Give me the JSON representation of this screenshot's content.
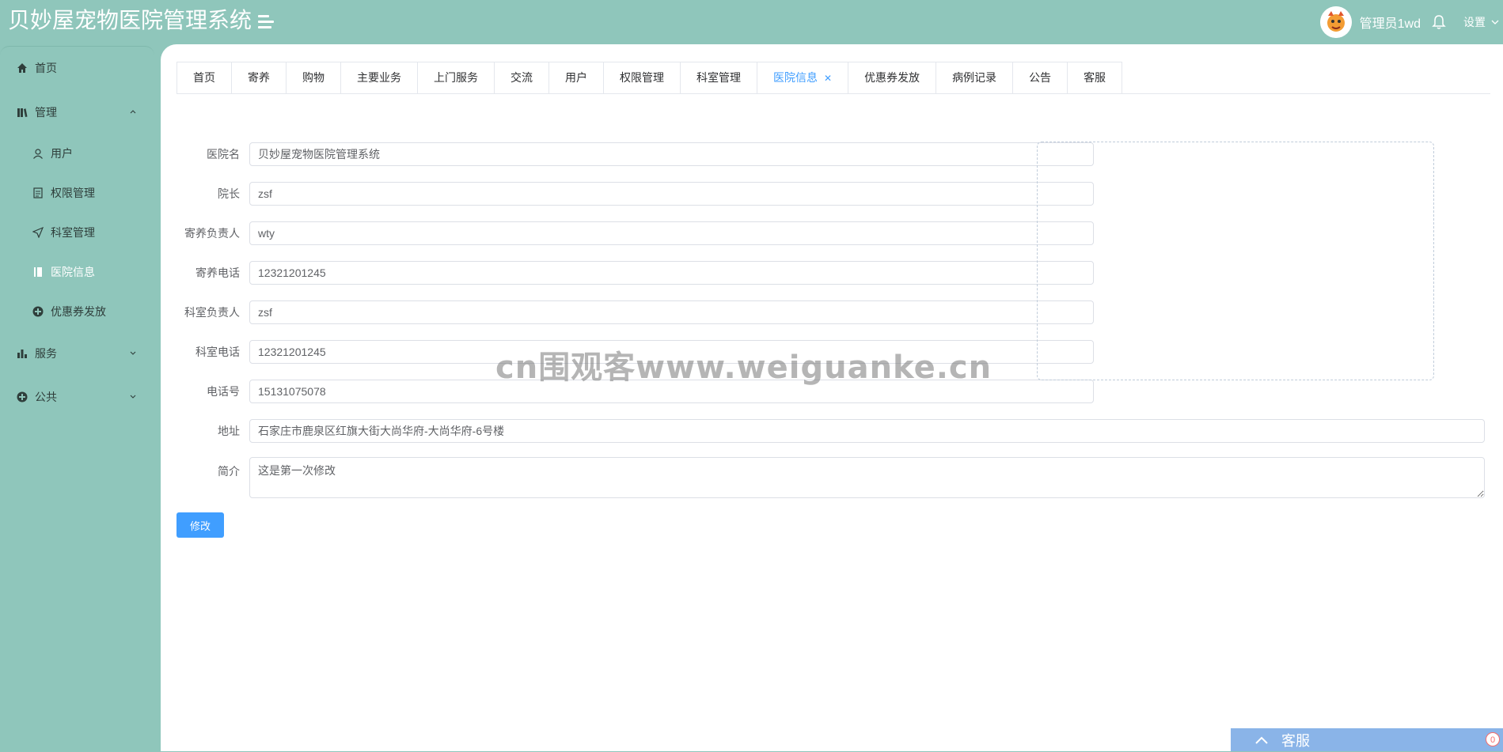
{
  "header": {
    "title": "贝妙屋宠物医院管理系统",
    "username": "管理员1wd",
    "settings_label": "设置"
  },
  "sidebar": {
    "items": [
      {
        "label": "首页",
        "icon": "home-icon"
      },
      {
        "label": "管理",
        "icon": "book-icon",
        "expanded": true
      },
      {
        "label": "用户",
        "icon": "user-icon"
      },
      {
        "label": "权限管理",
        "icon": "document-icon"
      },
      {
        "label": "科室管理",
        "icon": "send-icon"
      },
      {
        "label": "医院信息",
        "icon": "notebook-icon"
      },
      {
        "label": "优惠券发放",
        "icon": "plus-circle-icon"
      },
      {
        "label": "服务",
        "icon": "bar-chart-icon",
        "expanded": false
      },
      {
        "label": "公共",
        "icon": "plus-circle-icon",
        "expanded": false
      }
    ]
  },
  "tabs": [
    {
      "label": "首页"
    },
    {
      "label": "寄养"
    },
    {
      "label": "购物"
    },
    {
      "label": "主要业务"
    },
    {
      "label": "上门服务"
    },
    {
      "label": "交流"
    },
    {
      "label": "用户"
    },
    {
      "label": "权限管理"
    },
    {
      "label": "科室管理"
    },
    {
      "label": "医院信息",
      "active": true
    },
    {
      "label": "优惠券发放"
    },
    {
      "label": "病例记录"
    },
    {
      "label": "公告"
    },
    {
      "label": "客服"
    }
  ],
  "form": {
    "fields": [
      {
        "label": "医院名",
        "value": "贝妙屋宠物医院管理系统"
      },
      {
        "label": "院长",
        "value": "zsf"
      },
      {
        "label": "寄养负责人",
        "value": "wty"
      },
      {
        "label": "寄养电话",
        "value": "12321201245"
      },
      {
        "label": "科室负责人",
        "value": "zsf"
      },
      {
        "label": "科室电话",
        "value": "12321201245"
      },
      {
        "label": "电话号",
        "value": "15131075078"
      },
      {
        "label": "地址",
        "value": "石家庄市鹿泉区红旗大街大尚华府-大尚华府-6号楼"
      },
      {
        "label": "简介",
        "value": "这是第一次修改"
      }
    ],
    "submit_label": "修改"
  },
  "watermark": "cn围观客www.weiguanke.cn",
  "chat": {
    "label": "客服",
    "badge": "0"
  },
  "colors": {
    "theme": "#8fc6bb",
    "primary": "#409eff",
    "chat_bar": "#8ab4e8"
  }
}
